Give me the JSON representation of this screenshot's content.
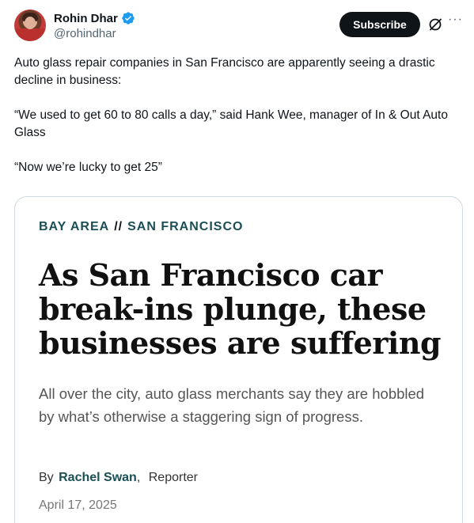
{
  "header": {
    "display_name": "Rohin Dhar",
    "handle": "@rohindhar",
    "subscribe_label": "Subscribe",
    "more_label": "···"
  },
  "tweet": {
    "paragraph1": "Auto glass repair companies in San Francisco are apparently seeing a drastic decline in business:",
    "paragraph2": "“We used to get 60 to 80 calls a day,” said Hank Wee, manager of In & Out Auto Glass",
    "paragraph3": "“Now we’re lucky to get 25”"
  },
  "card": {
    "kicker_left": "BAY AREA",
    "kicker_sep": "//",
    "kicker_right": "SAN FRANCISCO",
    "headline": "As San Francisco car break-ins plunge, these businesses are suffering",
    "dek": "All over the city, auto glass merchants say they are hobbled by what’s otherwise a staggering sign of progress.",
    "by": "By",
    "author": "Rachel Swan",
    "comma": ",",
    "role": "Reporter",
    "date": "April 17, 2025"
  },
  "colors": {
    "verified": "#1d9bf0",
    "subscribe_bg": "#0f1419",
    "kicker": "#1b4f55"
  },
  "icons": [
    "verified-badge-icon",
    "grok-icon",
    "more-icon"
  ]
}
